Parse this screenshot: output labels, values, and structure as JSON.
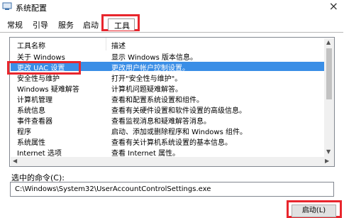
{
  "window": {
    "title": "系统配置",
    "close_glyph": "×"
  },
  "tabs": [
    {
      "label": "常规"
    },
    {
      "label": "引导"
    },
    {
      "label": "服务"
    },
    {
      "label": "启动"
    },
    {
      "label": "工具",
      "active": true
    }
  ],
  "list": {
    "columns": {
      "name": "工具名称",
      "description": "描述"
    },
    "rows": [
      {
        "name": "关于 Windows",
        "description": "显示 Windows 版本信息。"
      },
      {
        "name": "更改 UAC 设置",
        "description": "更改用户帐户控制设置。",
        "selected": true
      },
      {
        "name": "安全性与维护",
        "description": "打开\"安全性与维护\"。"
      },
      {
        "name": "Windows 疑难解答",
        "description": "计算机问题疑难解答。"
      },
      {
        "name": "计算机管理",
        "description": "查看和配置系统设置和组件。"
      },
      {
        "name": "系统信息",
        "description": "查看有关硬件设置和软件设置的高级信息。"
      },
      {
        "name": "事件查看器",
        "description": "查看监视消息和疑难解答消息。"
      },
      {
        "name": "程序",
        "description": "启动、添加或删除程序和 Windows 组件。"
      },
      {
        "name": "系统属性",
        "description": "查看有关计算机系统设置的基本信息。"
      },
      {
        "name": "Internet 选项",
        "description": "查看 Internet 属性。"
      }
    ]
  },
  "command": {
    "label": "选中的命令(C):",
    "value": "C:\\Windows\\System32\\UserAccountControlSettings.exe"
  },
  "buttons": {
    "launch": "启动(L)"
  },
  "colors": {
    "highlight": "#e8262d",
    "selection": "#3a8ee6"
  }
}
